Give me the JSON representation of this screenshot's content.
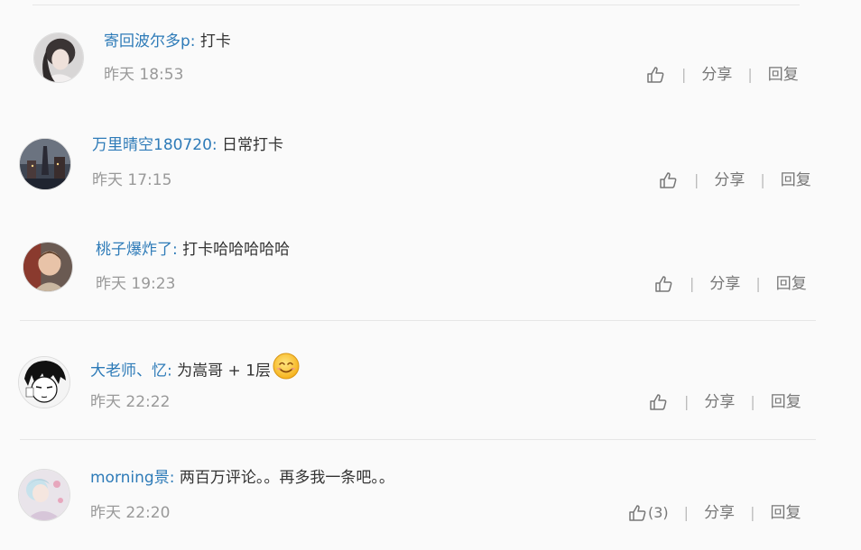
{
  "comments": [
    {
      "username": "寄回波尔多p",
      "colon": ":",
      "text": " 打卡",
      "time": "昨天 18:53",
      "like_count": "",
      "share_label": "分享",
      "reply_label": "回复",
      "separator": "|"
    },
    {
      "username": "万里晴空180720",
      "colon": ":",
      "text": " 日常打卡",
      "time": "昨天 17:15",
      "like_count": "",
      "share_label": "分享",
      "reply_label": "回复",
      "separator": "|"
    },
    {
      "username": "桃子爆炸了",
      "colon": ":",
      "text": " 打卡哈哈哈哈哈",
      "time": "昨天 19:23",
      "like_count": "",
      "share_label": "分享",
      "reply_label": "回复",
      "separator": "|"
    },
    {
      "username": "大老师、忆",
      "colon": ":",
      "text": " 为嵩哥 + 1层",
      "emoji": "smile-emoji",
      "time": "昨天 22:22",
      "like_count": "",
      "share_label": "分享",
      "reply_label": "回复",
      "separator": "|"
    },
    {
      "username": "morning景",
      "colon": ":",
      "text": " 两百万评论。。再多我一条吧。。",
      "time": "昨天 22:20",
      "like_count": "(3)",
      "share_label": "分享",
      "reply_label": "回复",
      "separator": "|"
    }
  ],
  "colors": {
    "username": "#2e7bb8",
    "text": "#333333",
    "meta": "#999999",
    "background": "#fafafa"
  }
}
